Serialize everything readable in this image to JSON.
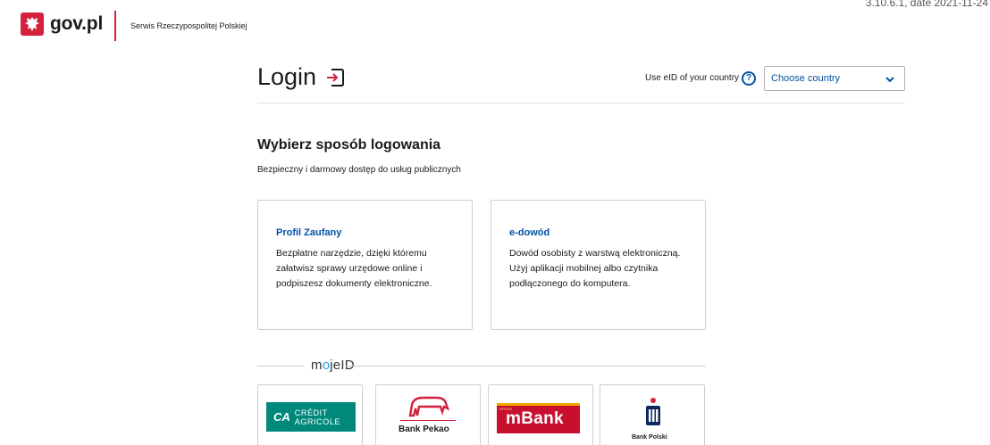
{
  "header": {
    "logo_text": "gov.pl",
    "service_name": "Serwis Rzeczypospolitej Polskiej",
    "version": "3.10.6.1, date 2021-11-24"
  },
  "login": {
    "title": "Login",
    "eid_label": "Use eID of your country",
    "help_symbol": "?",
    "country_select_value": "Choose country"
  },
  "section": {
    "title": "Wybierz sposób logowania",
    "subtitle": "Bezpieczny i darmowy dostęp do usług publicznych"
  },
  "cards": [
    {
      "title": "Profil Zaufany",
      "description": "Bezpłatne narzędzie, dzięki któremu załatwisz sprawy urzędowe online i podpiszesz dokumenty elektroniczne."
    },
    {
      "title": "e-dowód",
      "description": "Dowód osobisty z warstwą elektroniczną. Użyj aplikacji mobilnej albo czytnika podłączonego do komputera."
    }
  ],
  "mojeid": {
    "prefix": "m",
    "o": "o",
    "rest": "jeID"
  },
  "banks": [
    {
      "name": "Crédit Agricole",
      "line1": "CRÉDIT",
      "line2": "AGRICOLE",
      "mark": "CA"
    },
    {
      "name": "Bank Pekao",
      "label": "Bank Pekao"
    },
    {
      "name": "mBank",
      "label": "mBank",
      "tag": "GRUPA"
    },
    {
      "name": "PKO Bank Polski",
      "label": "Bank Polski"
    }
  ],
  "colors": {
    "brand_red": "#d4213d",
    "link_blue": "#0052a5",
    "ca_green": "#00897b",
    "mbank_red": "#c8102e",
    "pko_navy": "#0a2a5e"
  },
  "icons": {
    "login": "login-arrow-icon",
    "help": "question-circle-icon",
    "select": "chevron-down-icon",
    "logo": "polish-eagle-icon"
  }
}
